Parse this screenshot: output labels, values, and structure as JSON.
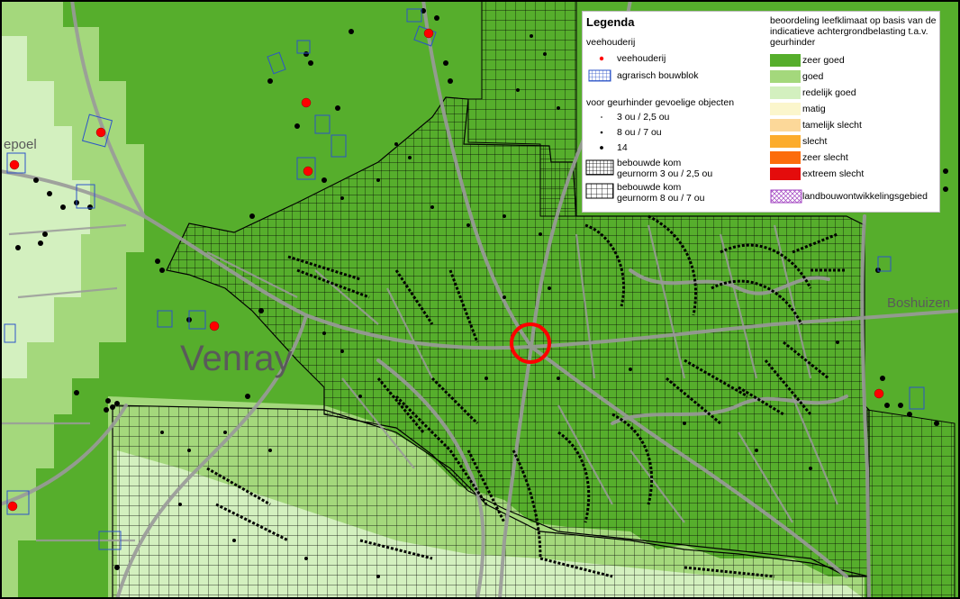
{
  "map": {
    "place_labels": [
      "Venray",
      "Boshuizen",
      "epoel"
    ],
    "colors": {
      "zeer_goed": "#56ae2c",
      "goed": "#a4d87c",
      "redelijk_goed": "#d3f0bf",
      "matig": "#fbf6cc",
      "tamelijk_slecht": "#fcd899",
      "slecht": "#fcac2c",
      "zeer_slecht": "#fc6c0c",
      "extreem_slecht": "#e40c0c",
      "road": "#9a9a9a",
      "grid_line": "#000000",
      "veehouderij_dot": "#ff0000",
      "bouwblok_outline": "#2c54c8",
      "marker_circle": "#ff0000"
    }
  },
  "legend": {
    "title": "Legenda",
    "veehouderij_heading": "veehouderij",
    "veehouderij_items": [
      "veehouderij",
      "agrarisch bouwblok"
    ],
    "objects_heading": "voor geurhinder gevoelige objecten",
    "objects_items": [
      "3 ou / 2,5 ou",
      "8 ou / 7 ou",
      "14"
    ],
    "kom_items": [
      "bebouwde kom geurnorm 3 ou / 2,5 ou",
      "bebouwde kom geurnorm 8 ou / 7 ou"
    ],
    "class_heading": "beoordeling leefklimaat op basis van de indicatieve achtergrondbelasting t.a.v. geurhinder",
    "classes": [
      "zeer goed",
      "goed",
      "redelijk goed",
      "matig",
      "tamelijk slecht",
      "slecht",
      "zeer slecht",
      "extreem slecht"
    ],
    "development_area": "landbouwontwikkelingsgebied"
  }
}
